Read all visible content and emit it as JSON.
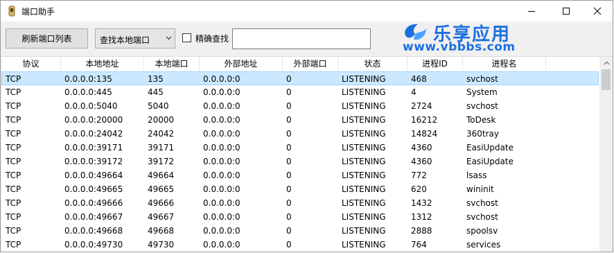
{
  "window": {
    "title": "端口助手"
  },
  "toolbar": {
    "refresh_label": "刷新端口列表",
    "find_select_value": "查找本地端口",
    "exact_checkbox_label": "精确查找",
    "search_value": ""
  },
  "watermark": {
    "top": "乐享应用",
    "bottom": "www.vbbbs.com"
  },
  "table": {
    "columns": [
      "协议",
      "本地地址",
      "本地端口",
      "外部地址",
      "外部端口",
      "状态",
      "进程ID",
      "进程名"
    ],
    "rows": [
      [
        "TCP",
        "0.0.0.0:135",
        "135",
        "0.0.0.0:0",
        "0",
        "LISTENING",
        "468",
        "svchost"
      ],
      [
        "TCP",
        "0.0.0.0:445",
        "445",
        "0.0.0.0:0",
        "0",
        "LISTENING",
        "4",
        "System"
      ],
      [
        "TCP",
        "0.0.0.0:5040",
        "5040",
        "0.0.0.0:0",
        "0",
        "LISTENING",
        "2724",
        "svchost"
      ],
      [
        "TCP",
        "0.0.0.0:20000",
        "20000",
        "0.0.0.0:0",
        "0",
        "LISTENING",
        "16212",
        "ToDesk"
      ],
      [
        "TCP",
        "0.0.0.0:24042",
        "24042",
        "0.0.0.0:0",
        "0",
        "LISTENING",
        "14824",
        "360tray"
      ],
      [
        "TCP",
        "0.0.0.0:39171",
        "39171",
        "0.0.0.0:0",
        "0",
        "LISTENING",
        "4360",
        "EasiUpdate"
      ],
      [
        "TCP",
        "0.0.0.0:39172",
        "39172",
        "0.0.0.0:0",
        "0",
        "LISTENING",
        "4360",
        "EasiUpdate"
      ],
      [
        "TCP",
        "0.0.0.0:49664",
        "49664",
        "0.0.0.0:0",
        "0",
        "LISTENING",
        "772",
        "lsass"
      ],
      [
        "TCP",
        "0.0.0.0:49665",
        "49665",
        "0.0.0.0:0",
        "0",
        "LISTENING",
        "620",
        "wininit"
      ],
      [
        "TCP",
        "0.0.0.0:49666",
        "49666",
        "0.0.0.0:0",
        "0",
        "LISTENING",
        "1432",
        "svchost"
      ],
      [
        "TCP",
        "0.0.0.0:49667",
        "49667",
        "0.0.0.0:0",
        "0",
        "LISTENING",
        "1312",
        "svchost"
      ],
      [
        "TCP",
        "0.0.0.0:49668",
        "49668",
        "0.0.0.0:0",
        "0",
        "LISTENING",
        "2888",
        "spoolsv"
      ],
      [
        "TCP",
        "0.0.0.0:49730",
        "49730",
        "0.0.0.0:0",
        "0",
        "LISTENING",
        "764",
        "services"
      ]
    ],
    "selected_row": 0
  },
  "colors": {
    "selection": "#cce8ff",
    "watermark": "#1b6fe0"
  }
}
